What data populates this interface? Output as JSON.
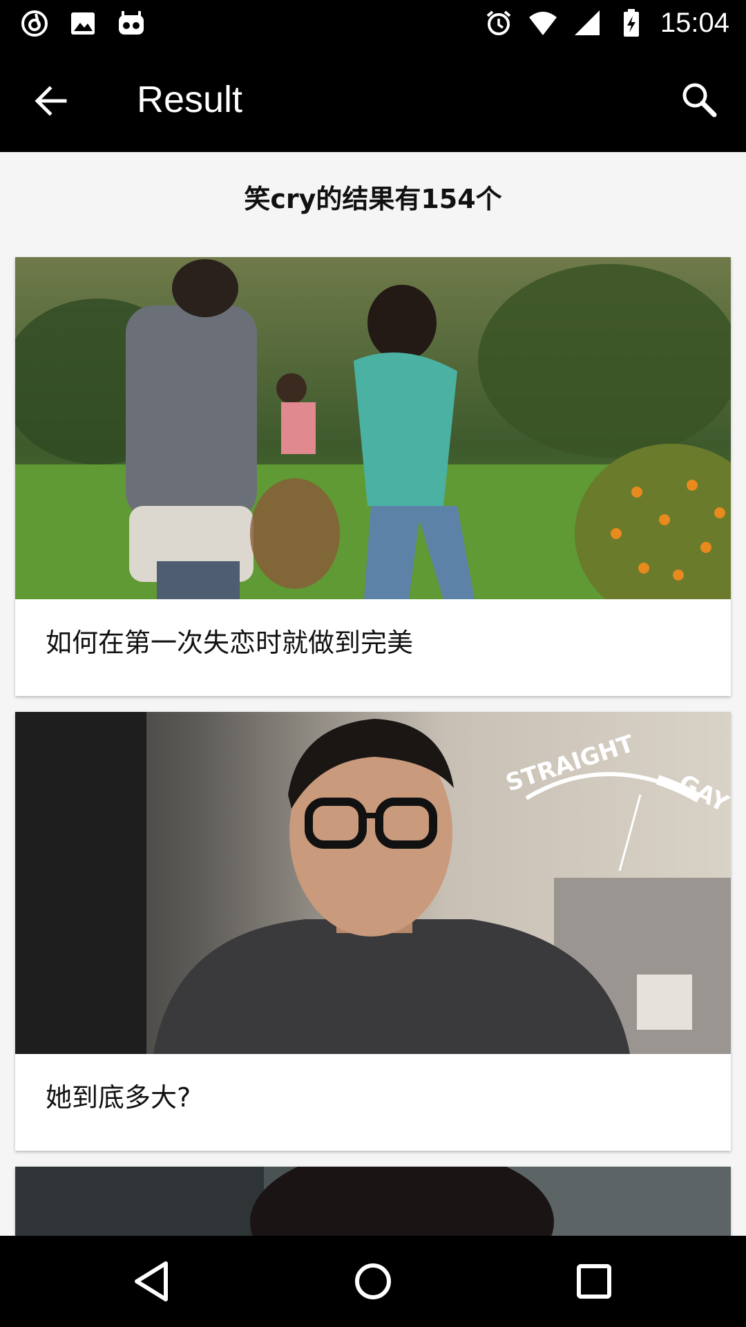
{
  "status_bar": {
    "time": "15:04",
    "left_icons": [
      "netease-music-icon",
      "image-icon",
      "cyanogen-icon"
    ],
    "right_icons": [
      "alarm-icon",
      "wifi-icon",
      "signal-icon",
      "battery-charging-icon"
    ]
  },
  "toolbar": {
    "title": "Result",
    "back_icon": "arrow-back-icon",
    "search_icon": "search-icon"
  },
  "results": {
    "summary": "笑cry的结果有154个",
    "items": [
      {
        "title": "如何在第一次失恋时就做到完美"
      },
      {
        "title": "她到底多大?"
      },
      {
        "title": ""
      }
    ]
  },
  "nav_bar": {
    "icons": [
      "nav-back-icon",
      "nav-home-icon",
      "nav-recents-icon"
    ]
  },
  "colors": {
    "bars": "#000000",
    "content_bg": "#f5f5f5",
    "card_bg": "#ffffff",
    "text": "#111111"
  }
}
